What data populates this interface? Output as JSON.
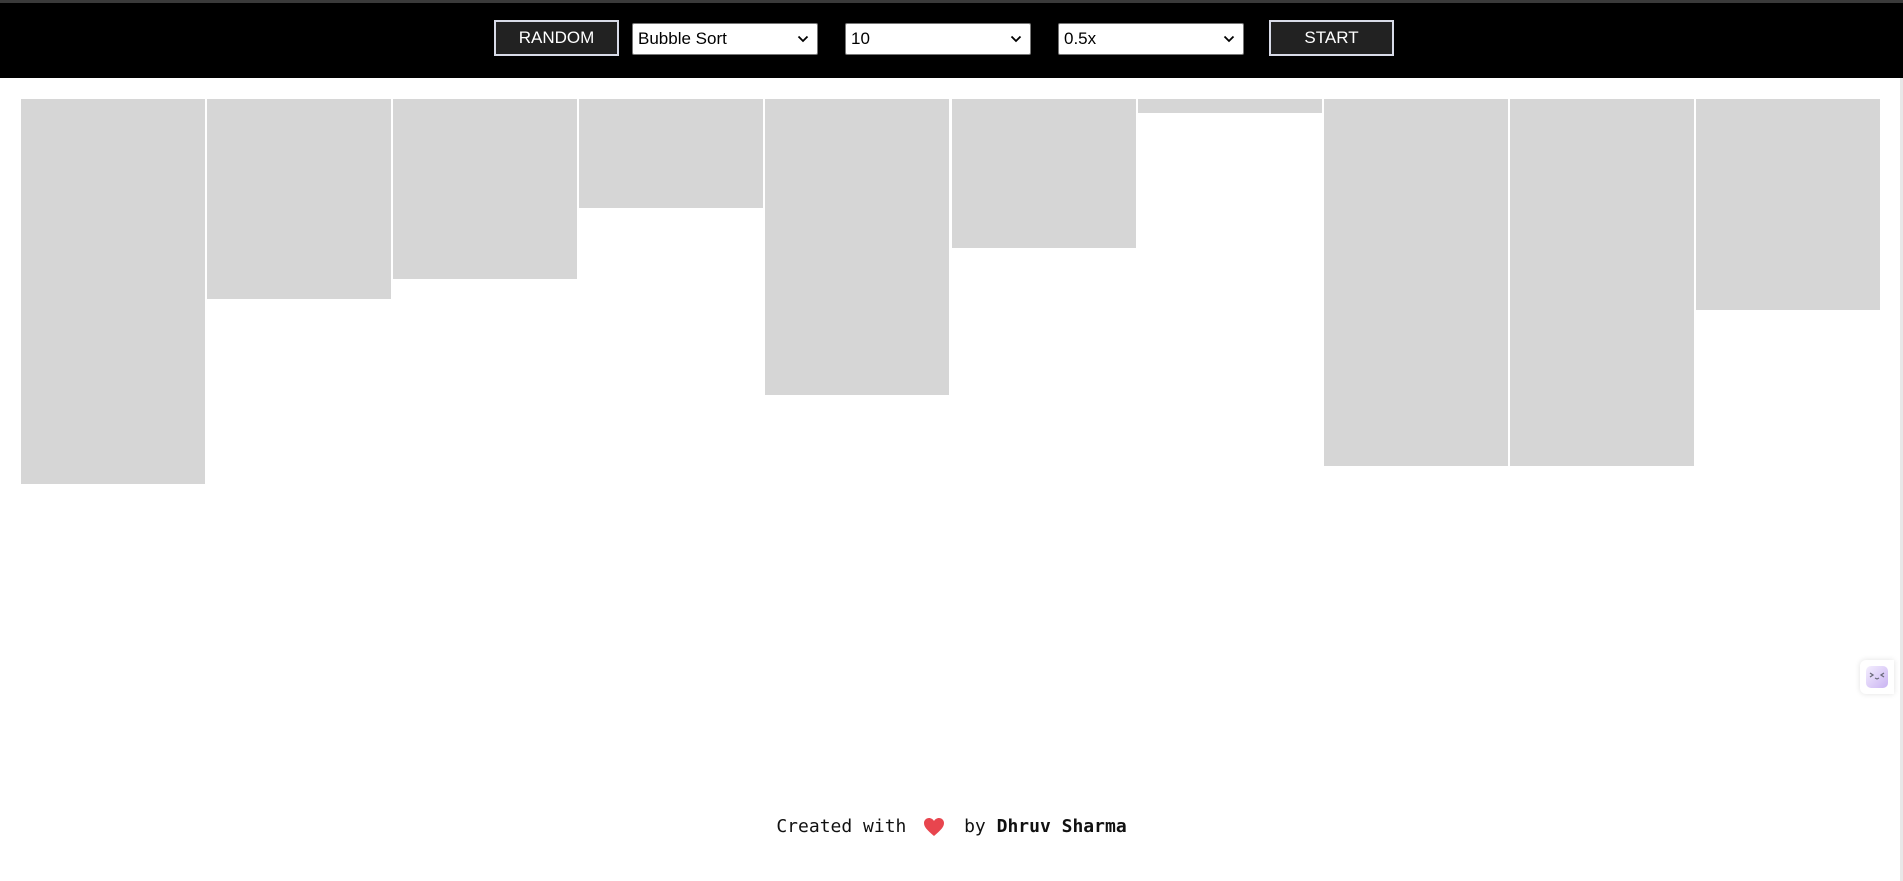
{
  "toolbar": {
    "random_label": "RANDOM",
    "start_label": "START",
    "algorithm_select": {
      "selected": "Bubble Sort"
    },
    "size_select": {
      "selected": "10"
    },
    "speed_select": {
      "selected": "0.5x"
    }
  },
  "bars": {
    "count": 10,
    "values": [
      0.82,
      0.425,
      0.383,
      0.232,
      0.63,
      0.318,
      0.03,
      0.78,
      0.78,
      0.448
    ],
    "color": "#d6d6d6"
  },
  "footer": {
    "prefix": "Created with",
    "heart_icon": "heart-icon",
    "by": "by",
    "author": "Dhruv Sharma"
  },
  "colors": {
    "navbar": "#000000",
    "button_bg": "#222222",
    "button_border": "#d8dbe8",
    "heart": "#e8454e",
    "bar": "#d6d6d6"
  },
  "side_widget": {
    "icon": "bot-face-icon"
  }
}
